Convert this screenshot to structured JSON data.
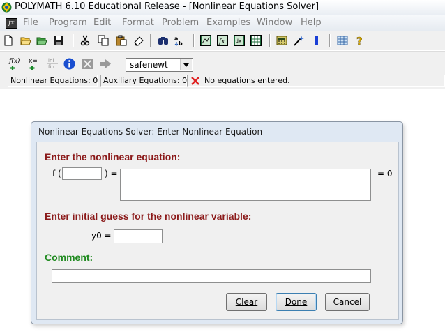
{
  "window": {
    "title": "POLYMATH 6.10 Educational Release - [Nonlinear Equations Solver]"
  },
  "menu": {
    "items": [
      "File",
      "Program",
      "Edit",
      "Format",
      "Problem",
      "Examples",
      "Window",
      "Help"
    ]
  },
  "toolbar1": {
    "icons": [
      "new-file-icon",
      "open-folder-icon",
      "open-examples-icon",
      "save-icon",
      "cut-icon",
      "copy-icon",
      "paste-icon",
      "eraser-icon",
      "binoculars-icon",
      "sort-icon",
      "graph-icon",
      "function-icon",
      "dx-icon",
      "table-icon",
      "calculator-icon",
      "wand-icon",
      "exclamation-icon",
      "grid-icon",
      "help-question-icon"
    ]
  },
  "toolbar2": {
    "add_equation_label": "f(x)",
    "add_explicit_label": "x=",
    "add_ini_label": "ini",
    "add_fin_label": "fin",
    "method_value": "safenewt"
  },
  "status": {
    "nonlinear": "Nonlinear Equations: 0",
    "auxiliary": "Auxiliary Equations: 0",
    "message": "No equations entered."
  },
  "dialog": {
    "title": "Nonlinear Equations Solver: Enter Nonlinear Equation",
    "enter_equation_heading": "Enter the nonlinear equation:",
    "f_open": "f (",
    "f_close": ") =",
    "equals_zero": "= 0",
    "initial_guess_heading": "Enter initial guess for the nonlinear variable:",
    "y0_label": "y0 =",
    "comment_heading": "Comment:",
    "buttons": {
      "clear": "Clear",
      "done": "Done",
      "cancel": "Cancel"
    },
    "fields": {
      "variable": "",
      "equation": "",
      "initial_guess": "",
      "comment": ""
    }
  },
  "colors": {
    "heading_red": "#8b1a1a",
    "heading_green": "#1f8a1f",
    "dialog_frame": "#dfe8f3",
    "status_error": "#e02020"
  }
}
